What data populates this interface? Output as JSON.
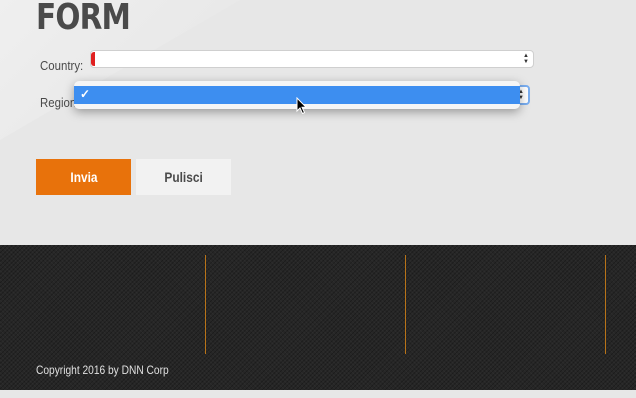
{
  "form": {
    "title": "FORM",
    "country_label": "Country:",
    "region_label": "Region",
    "country_value": "",
    "region_value": ""
  },
  "dropdown": {
    "options": [
      {
        "label": "",
        "selected": true,
        "check": "✓"
      }
    ]
  },
  "buttons": {
    "submit_label": "Invia",
    "clear_label": "Pulisci"
  },
  "footer": {
    "copyright": "Copyright 2016 by DNN Corp"
  },
  "colors": {
    "accent": "#e8720b",
    "selection": "#3d8ef0",
    "required": "#e02020",
    "footer_bg": "#262626"
  },
  "icons": [
    "select-arrows-icon",
    "checkmark-icon",
    "mouse-pointer-icon"
  ]
}
